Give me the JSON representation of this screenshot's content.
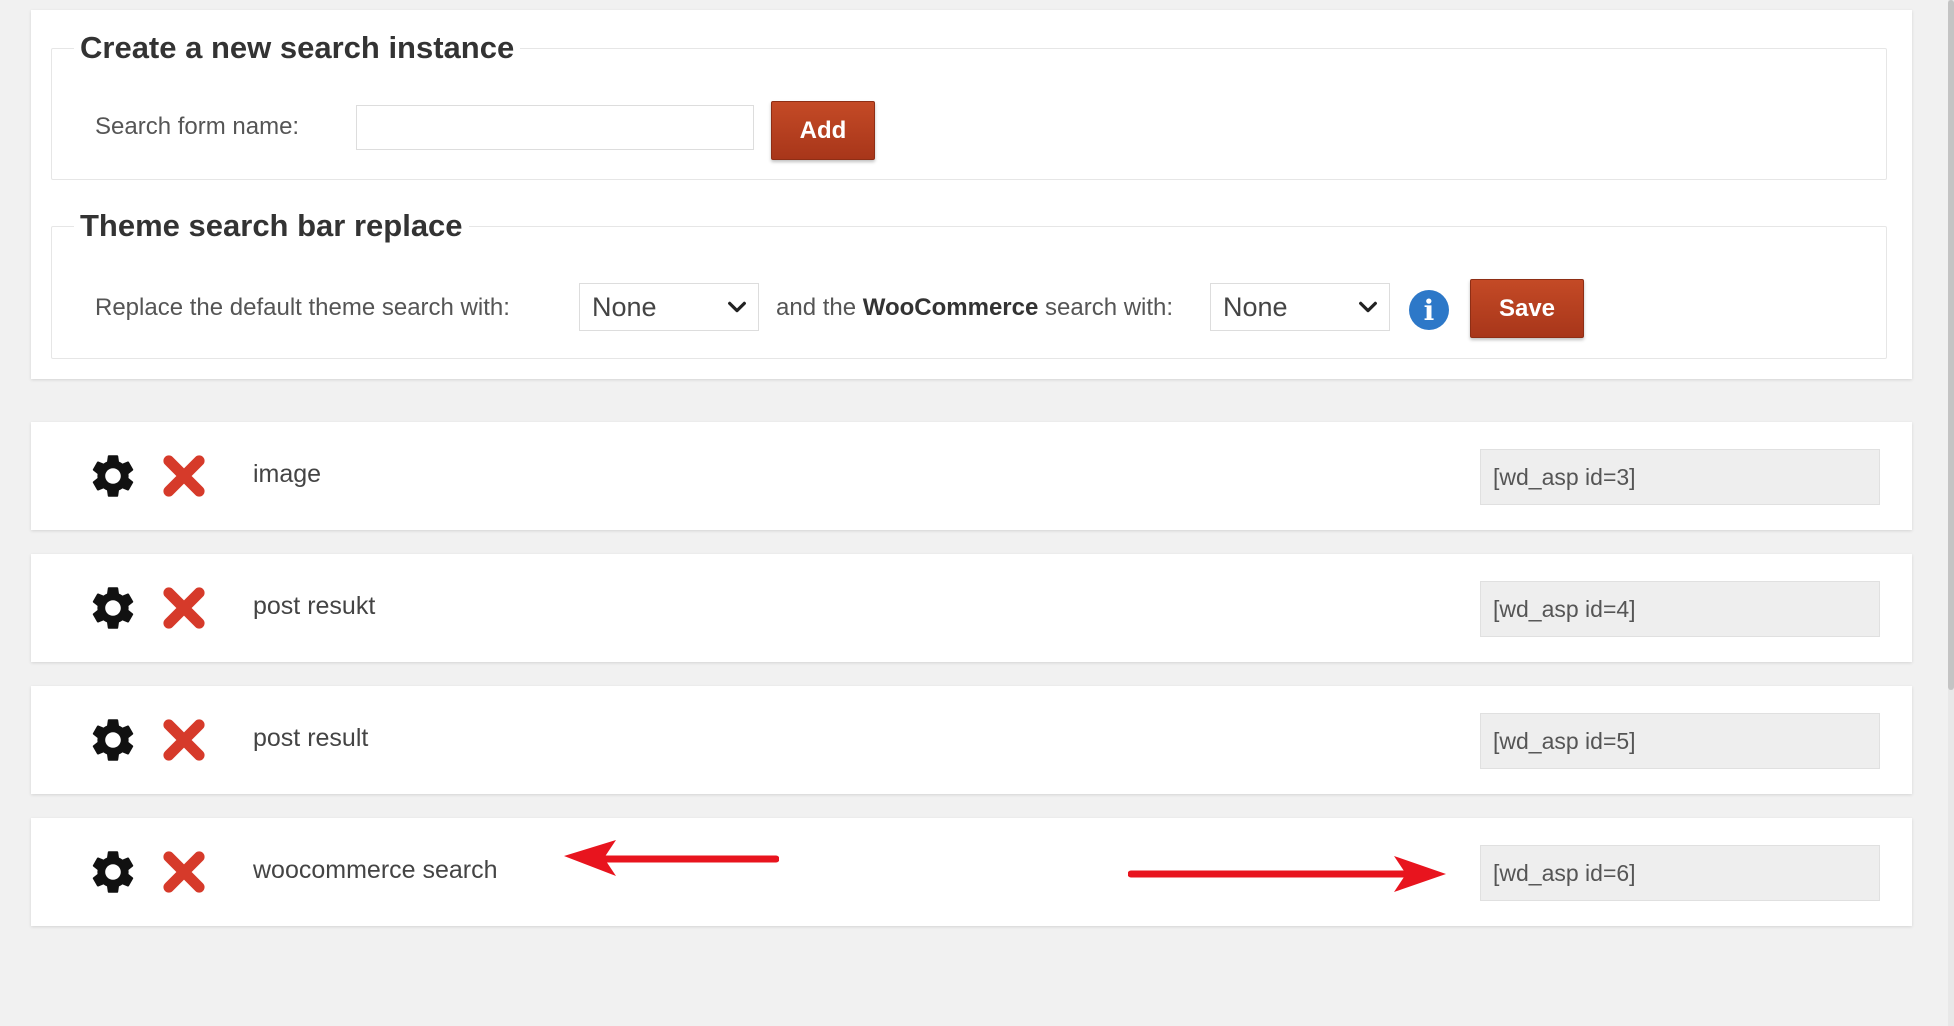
{
  "create_section": {
    "title": "Create a new search instance",
    "name_label": "Search form name:",
    "name_value": "",
    "add_label": "Add"
  },
  "theme_section": {
    "title": "Theme search bar replace",
    "replace_label": "Replace the default theme search with:",
    "and_the_prefix": "and the",
    "woocommerce_bold": "WooCommerce",
    "search_with_suffix": "search with:",
    "theme_select_value": "None",
    "woo_select_value": "None",
    "info_glyph": "i",
    "save_label": "Save"
  },
  "search_instances": [
    {
      "name": "image",
      "shortcode": "[wd_asp id=3]"
    },
    {
      "name": "post resukt",
      "shortcode": "[wd_asp id=4]"
    },
    {
      "name": "post result",
      "shortcode": "[wd_asp id=5]"
    },
    {
      "name": "woocommerce search",
      "shortcode": "[wd_asp id=6]"
    }
  ],
  "icons": {
    "settings": "gear-icon",
    "delete": "close-icon",
    "info": "info-icon",
    "dropdown": "chevron-down-icon",
    "annotation": "arrow-icon"
  },
  "colors": {
    "button_red": "#b83b1c",
    "delete_red": "#d63a2a",
    "info_blue": "#2d78c8",
    "annotation_arrow": "#e8141e"
  }
}
